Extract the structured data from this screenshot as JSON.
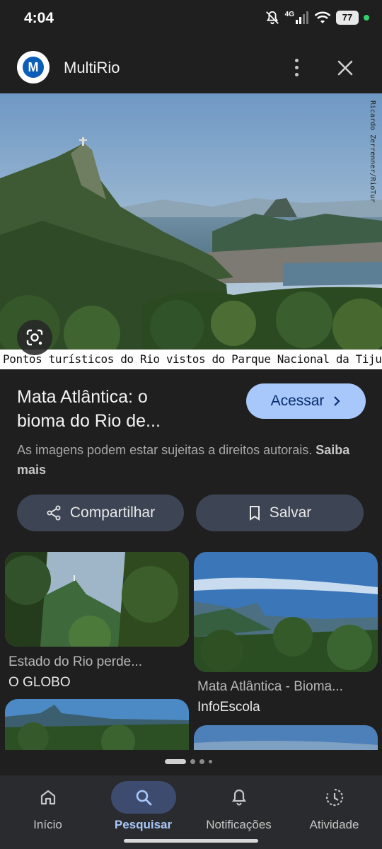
{
  "status": {
    "time": "4:04",
    "network": "4G",
    "battery": "77"
  },
  "header": {
    "site_name": "MultiRio",
    "logo_letter": "M",
    "more_icon": "more-vert-icon",
    "close_icon": "close-icon"
  },
  "hero": {
    "caption": "Pontos turísticos do Rio vistos do Parque Nacional da Tijuca",
    "credit": "Ricardo Zerrenner/RioTur"
  },
  "result": {
    "title_line1": "Mata Atlântica: o",
    "title_line2": "bioma do Rio de...",
    "visit_label": "Acessar",
    "rights_text": "As imagens podem estar sujeitas a direitos autorais.",
    "learn_more": "Saiba mais"
  },
  "actions": {
    "share_label": "Compartilhar",
    "save_label": "Salvar"
  },
  "related": [
    {
      "title": "Estado do Rio perde...",
      "source": "O GLOBO"
    },
    {
      "title": "Mata Atlântica - Bioma...",
      "source": "InfoEscola"
    }
  ],
  "nav": [
    {
      "label": "Início",
      "icon": "home-icon"
    },
    {
      "label": "Pesquisar",
      "icon": "search-icon",
      "active": true
    },
    {
      "label": "Notificações",
      "icon": "bell-icon"
    },
    {
      "label": "Atividade",
      "icon": "activity-icon"
    }
  ],
  "colors": {
    "accent": "#a8c7fa",
    "button_bg": "#3d4555",
    "background": "#1f1f1f"
  }
}
